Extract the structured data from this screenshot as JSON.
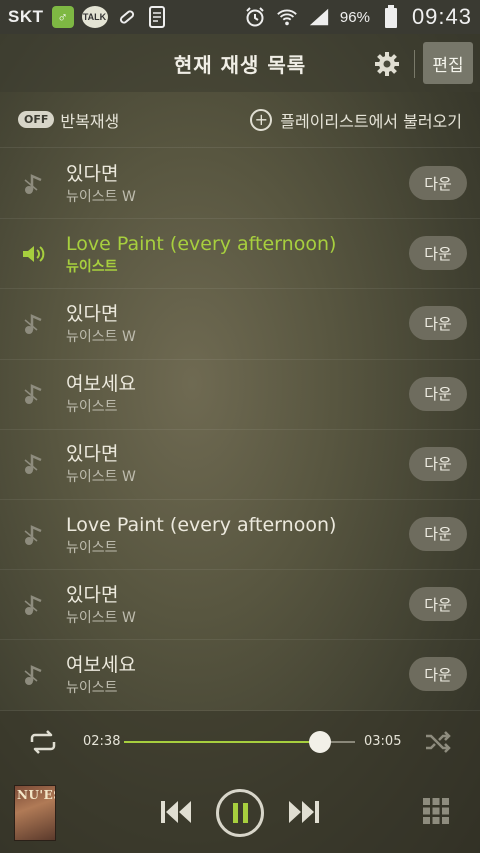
{
  "status_bar": {
    "carrier": "SKT",
    "talk_label": "TALK",
    "battery_percent": "96%",
    "clock": "09:43"
  },
  "header": {
    "title": "현재 재생 목록",
    "edit_label": "편집"
  },
  "options": {
    "repeat_badge": "OFF",
    "repeat_label": "반복재생",
    "load_playlist_label": "플레이리스트에서 불러오기"
  },
  "playlist": [
    {
      "song": "있다면",
      "artist": "뉴이스트 W",
      "download_label": "다운",
      "active": false
    },
    {
      "song": "Love Paint (every afternoon)",
      "artist": "뉴이스트",
      "download_label": "다운",
      "active": true
    },
    {
      "song": "있다면",
      "artist": "뉴이스트 W",
      "download_label": "다운",
      "active": false
    },
    {
      "song": "여보세요",
      "artist": "뉴이스트",
      "download_label": "다운",
      "active": false
    },
    {
      "song": "있다면",
      "artist": "뉴이스트 W",
      "download_label": "다운",
      "active": false
    },
    {
      "song": "Love Paint (every afternoon)",
      "artist": "뉴이스트",
      "download_label": "다운",
      "active": false
    },
    {
      "song": "있다면",
      "artist": "뉴이스트 W",
      "download_label": "다운",
      "active": false
    },
    {
      "song": "여보세요",
      "artist": "뉴이스트",
      "download_label": "다운",
      "active": false
    }
  ],
  "player": {
    "current_time": "02:38",
    "total_time": "03:05",
    "progress_fraction": 0.85,
    "album_text": "NU'EST",
    "state": "playing"
  },
  "colors": {
    "accent": "#a7cf3e",
    "download_button": "#6e6c5e"
  },
  "icons": [
    "settings-gear-icon",
    "add-circle-icon",
    "music-note-icon",
    "speaker-playing-icon",
    "repeat-icon",
    "shuffle-icon",
    "previous-track-icon",
    "pause-icon",
    "next-track-icon",
    "grid-menu-icon"
  ]
}
